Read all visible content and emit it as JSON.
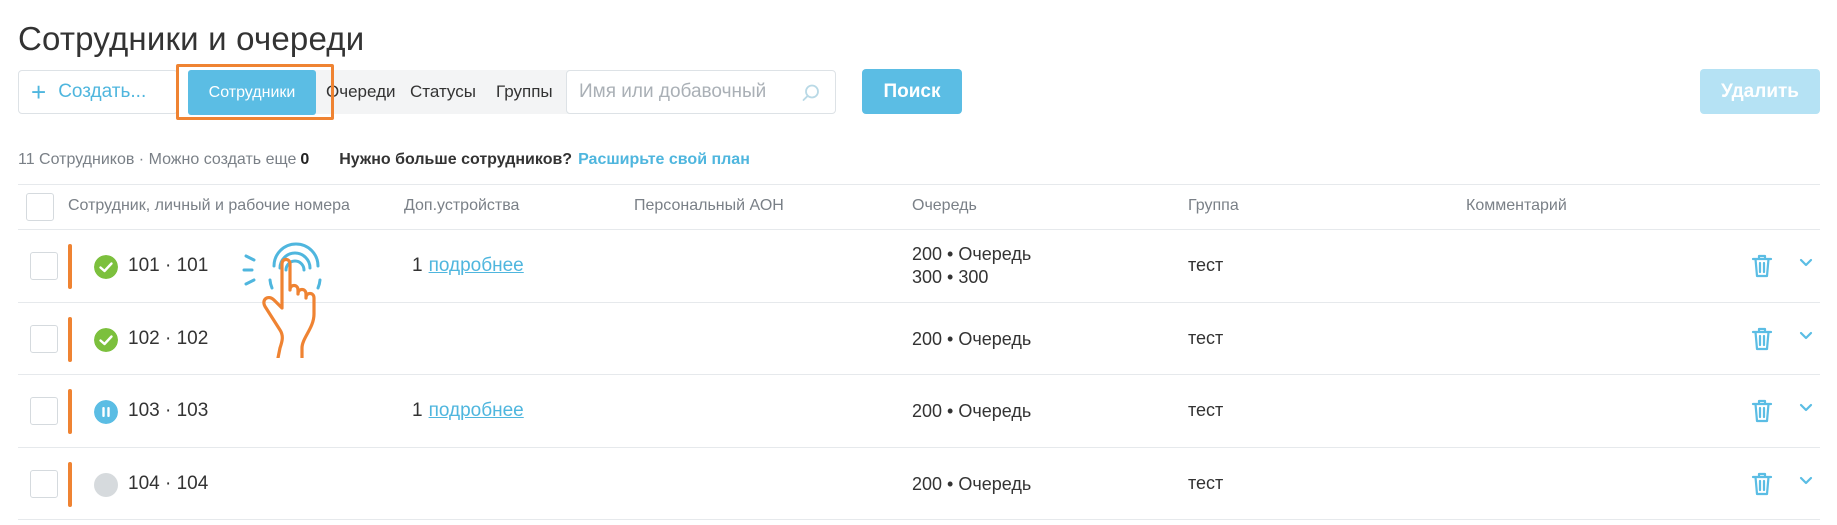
{
  "page": {
    "title": "Сотрудники и очереди"
  },
  "toolbar": {
    "create_label": "Создать...",
    "tabs": [
      {
        "label": "Сотрудники",
        "active": true
      },
      {
        "label": "Очереди"
      },
      {
        "label": "Статусы"
      },
      {
        "label": "Группы"
      }
    ],
    "search_placeholder": "Имя или добавочный",
    "search_value": "",
    "search_button": "Поиск",
    "delete_button": "Удалить"
  },
  "info": {
    "text": "11 Сотрудников · Можно создать еще",
    "count": "0",
    "need_more": "Нужно больше сотрудников?",
    "expand_link": "Расширьте свой план"
  },
  "table": {
    "columns": [
      "Сотрудник, личный и рабочие номера",
      "Доп.устройства",
      "Персональный АОН",
      "Очередь",
      "Группа",
      "Комментарий"
    ],
    "rows": [
      {
        "status": "online",
        "ext": "101 · 101",
        "devices_count": "1",
        "devices_link": "подробнее",
        "queues": [
          "200 • Очередь",
          "300 • 300"
        ],
        "group": "тест",
        "comment": ""
      },
      {
        "status": "online",
        "ext": "102 · 102",
        "devices_count": "",
        "devices_link": "",
        "queues": [
          "200 • Очередь"
        ],
        "group": "тест",
        "comment": ""
      },
      {
        "status": "pause",
        "ext": "103 · 103",
        "devices_count": "1",
        "devices_link": "подробнее",
        "queues": [
          "200 • Очередь"
        ],
        "group": "тест",
        "comment": ""
      },
      {
        "status": "offline",
        "ext": "104 · 104",
        "devices_count": "",
        "devices_link": "",
        "queues": [
          "200 • Очередь"
        ],
        "group": "тест",
        "comment": ""
      }
    ]
  },
  "colors": {
    "accent": "#5bbde4",
    "highlight": "#ef8332",
    "online": "#7cc03d",
    "offline": "#d6dadd"
  },
  "icons": {
    "create": "plus-icon",
    "search": "search-icon",
    "delete_row": "trash-icon",
    "expand_row": "chevron-down-icon",
    "pointer": "hand-tap-icon"
  }
}
